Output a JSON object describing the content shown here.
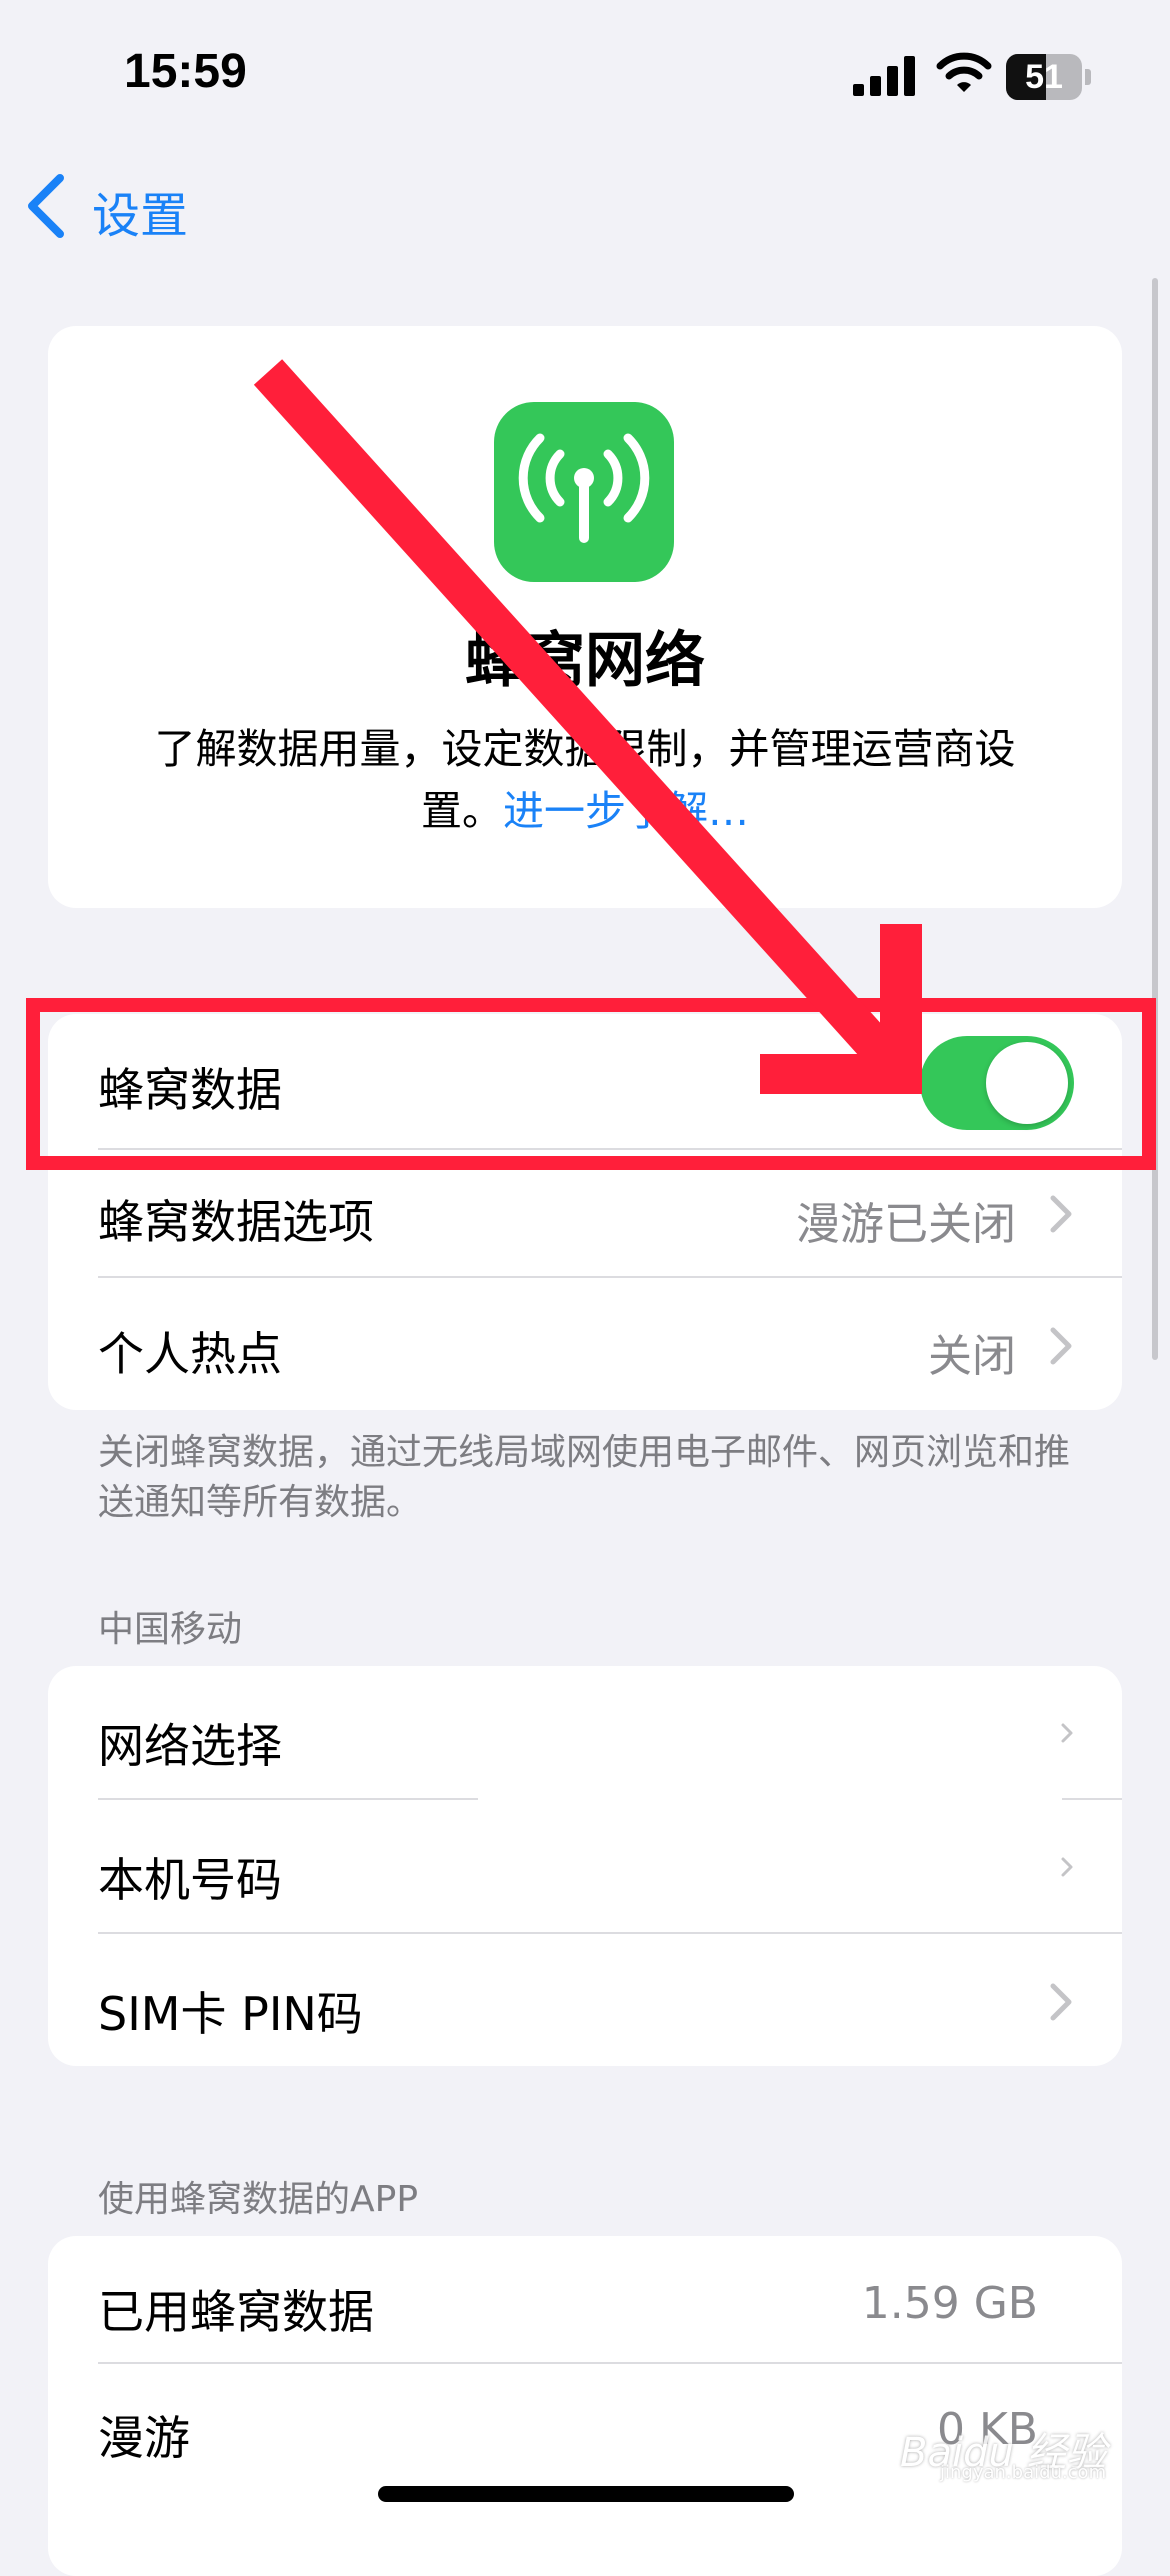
{
  "status_bar": {
    "time": "15:59",
    "battery": "51"
  },
  "nav": {
    "back_label": "设置"
  },
  "hero": {
    "title": "蜂窝网络",
    "description": "了解数据用量，设定数据限制，并管理运营商设置。",
    "link": "进一步了解…"
  },
  "group1": {
    "cellular_data": {
      "label": "蜂窝数据",
      "enabled": true
    },
    "cellular_options": {
      "label": "蜂窝数据选项",
      "value": "漫游已关闭"
    },
    "hotspot": {
      "label": "个人热点",
      "value": "关闭"
    }
  },
  "footnote": "关闭蜂窝数据，通过无线局域网使用电子邮件、网页浏览和推送通知等所有数据。",
  "carrier": {
    "header": "中国移动",
    "network_selection": "网络选择",
    "my_number": "本机号码",
    "sim_pin": "SIM卡 PIN码"
  },
  "apps": {
    "header": "使用蜂窝数据的APP",
    "used": {
      "label": "已用蜂窝数据",
      "value": "1.59 GB"
    },
    "roaming": {
      "label": "漫游",
      "value": "0 KB"
    }
  },
  "watermark": {
    "brand": "Baidu 经验",
    "url": "jingyan.baidu.com"
  },
  "colors": {
    "accent": "#1a82f7",
    "toggle_on": "#34c759",
    "annotation": "#ff1f3a"
  }
}
